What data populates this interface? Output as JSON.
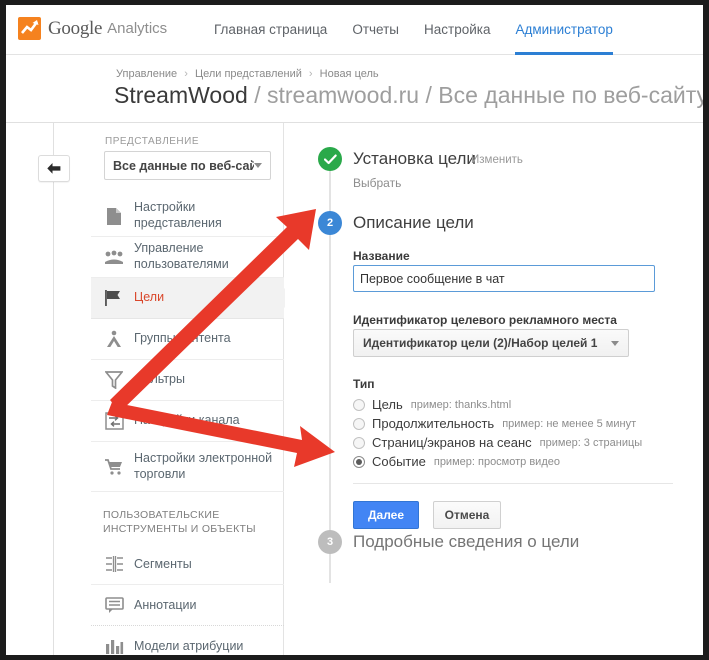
{
  "brand": {
    "google": "Google",
    "analytics": "Analytics",
    "logo_bg": "#f5821f"
  },
  "topnav": {
    "items": [
      {
        "label": "Главная страница",
        "active": false
      },
      {
        "label": "Отчеты",
        "active": false
      },
      {
        "label": "Настройка",
        "active": false
      },
      {
        "label": "Администратор",
        "active": true
      }
    ],
    "accent": "#2c7fd4"
  },
  "breadcrumb": {
    "items": [
      "Управление",
      "Цели представлений",
      "Новая цель"
    ],
    "separator": "›"
  },
  "page_title": {
    "account": "StreamWood",
    "property": "streamwood.ru",
    "view": "Все данные по веб-сайту",
    "separator": "/"
  },
  "back_button": {
    "icon": "back-arrow-icon"
  },
  "sidebar": {
    "view_label": "ПРЕДСТАВЛЕНИЕ",
    "view_select_value": "Все данные по веб-сайту",
    "items": [
      {
        "label": "Настройки представления",
        "icon": "document-icon",
        "selected": false
      },
      {
        "label": "Управление пользователями",
        "icon": "users-icon",
        "selected": false
      },
      {
        "label": "Цели",
        "icon": "flag-icon",
        "selected": true
      },
      {
        "label": "Группы контента",
        "icon": "content-group-icon",
        "selected": false
      },
      {
        "label": "Фильтры",
        "icon": "funnel-icon",
        "selected": false
      },
      {
        "label": "Настройки канала",
        "icon": "channel-icon",
        "selected": false
      },
      {
        "label": "Настройки электронной торговли",
        "icon": "cart-icon",
        "selected": false
      }
    ],
    "section_title": "ПОЛЬЗОВАТЕЛЬСКИЕ ИНСТРУМЕНТЫ И ОБЪЕКТЫ",
    "tool_items": [
      {
        "label": "Сегменты",
        "icon": "segments-icon"
      },
      {
        "label": "Аннотации",
        "icon": "annotations-icon"
      },
      {
        "label": "Модели атрибуции",
        "icon": "attribution-icon"
      }
    ],
    "selected_color": "#d9472b"
  },
  "main": {
    "step1": {
      "number": "✓",
      "title": "Установка цели",
      "edit_link": "Изменить",
      "sub": "Выбрать",
      "circle_color": "#2aa94a"
    },
    "step2": {
      "number": "2",
      "title": "Описание цели",
      "circle_color": "#3b87d6",
      "name_label": "Название",
      "name_value": "Первое сообщение в чат",
      "name_placeholder": "Название",
      "slot_label": "Идентификатор целевого рекламного места",
      "slot_value": "Идентификатор цели (2)/Набор целей 1",
      "type_label": "Тип",
      "types": [
        {
          "label": "Цель",
          "hint": "пример: thanks.html",
          "checked": false
        },
        {
          "label": "Продолжительность",
          "hint": "пример: не менее 5 минут",
          "checked": false
        },
        {
          "label": "Страниц/экранов на сеанс",
          "hint": "пример: 3 страницы",
          "checked": false
        },
        {
          "label": "Событие",
          "hint": "пример: просмотр видео",
          "checked": true
        }
      ],
      "next_button": "Далее",
      "cancel_button": "Отмена"
    },
    "step3": {
      "number": "3",
      "title": "Подробные сведения о цели",
      "circle_color": "#bdbdbd"
    }
  },
  "annotations": {
    "arrow_color": "#e8392a",
    "arrows": [
      {
        "name": "arrow-to-step2",
        "from": "sidebar-channel-settings",
        "to": "step2-heading"
      },
      {
        "name": "arrow-to-event-radio",
        "from": "sidebar-channel-settings",
        "to": "event-radio"
      }
    ]
  }
}
